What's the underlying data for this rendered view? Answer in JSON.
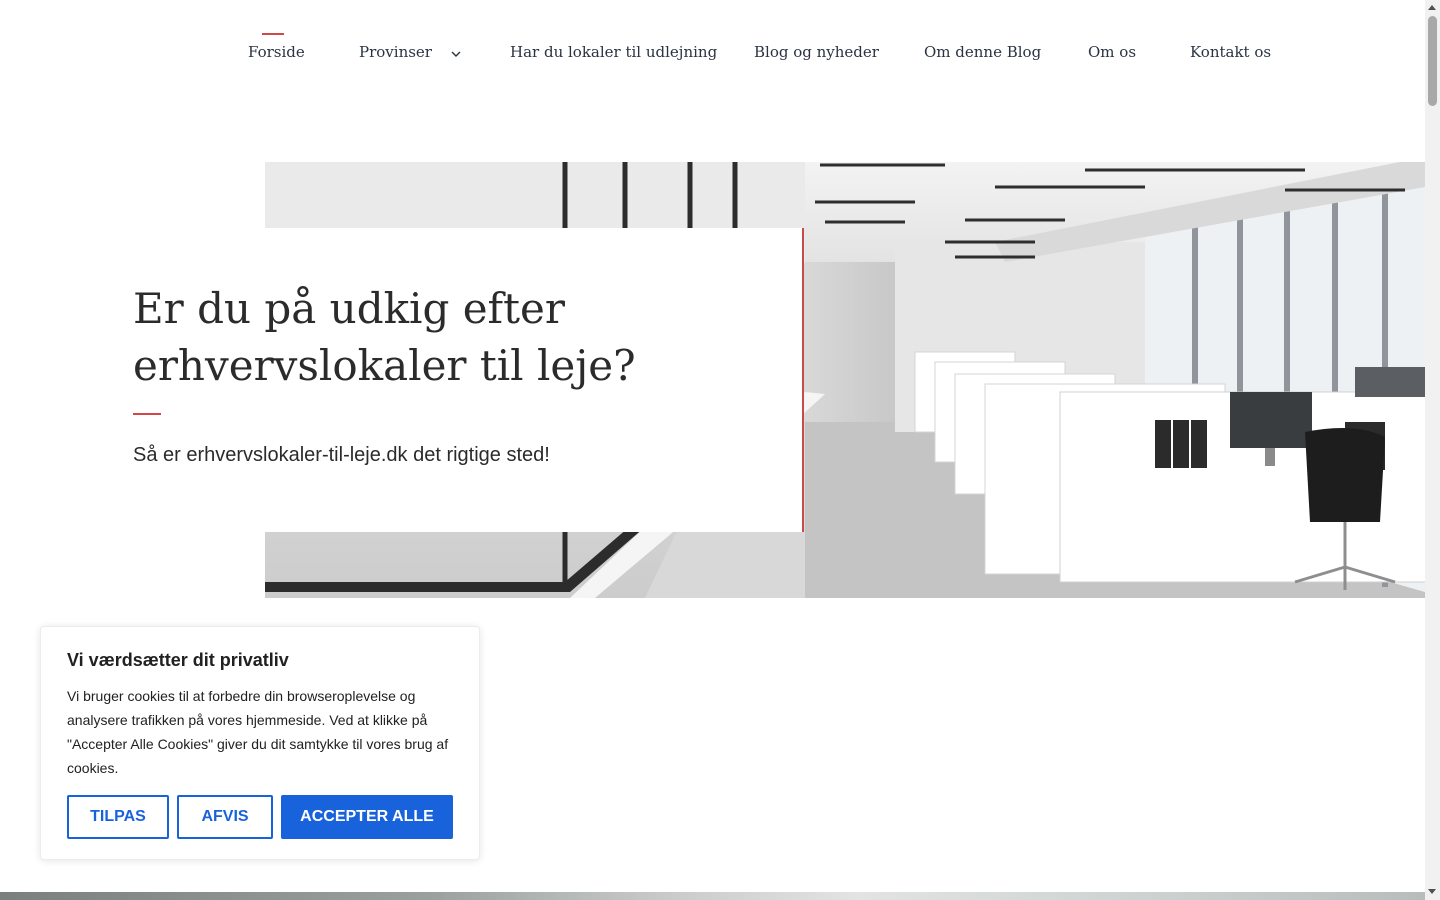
{
  "nav": {
    "items": [
      {
        "label": "Forside",
        "active": true
      },
      {
        "label": "Provinser",
        "has_dropdown": true
      },
      {
        "label": "Har du lokaler til udlejning"
      },
      {
        "label": "Blog og nyheder"
      },
      {
        "label": "Om denne Blog"
      },
      {
        "label": "Om os"
      },
      {
        "label": "Kontakt os"
      }
    ]
  },
  "hero": {
    "title": "Er du på udkig efter erhvervslokaler til leje?",
    "subtitle": "Så er erhvervslokaler-til-leje.dk det rigtige sted!"
  },
  "cookie": {
    "title": "Vi værdsætter dit privatliv",
    "text": "Vi bruger cookies til at forbedre din browseroplevelse og analysere trafikken på vores hjemmeside. Ved at klikke på \"Accepter Alle Cookies\" giver du dit samtykke til vores brug af cookies.",
    "buttons": {
      "customize": "TILPAS",
      "reject": "AFVIS",
      "accept": "ACCEPTER ALLE"
    }
  },
  "colors": {
    "accent_red": "#d24848",
    "cookie_blue": "#1863dc",
    "text_dark": "#2a3342"
  }
}
